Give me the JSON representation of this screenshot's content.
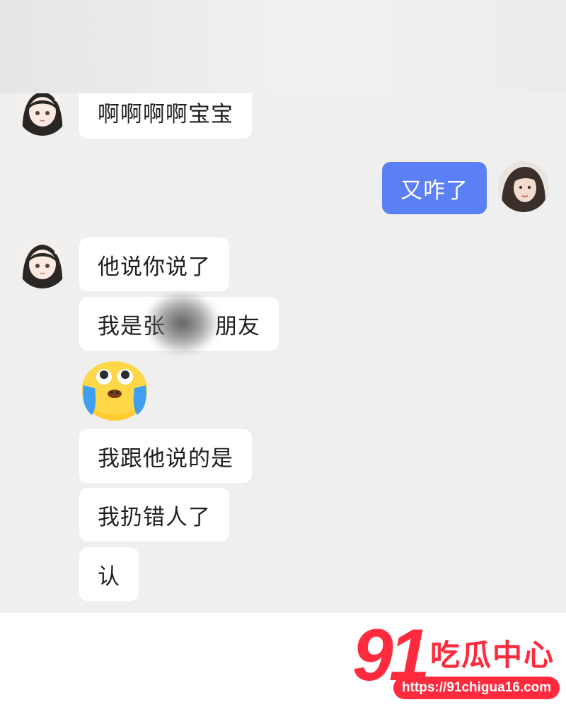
{
  "chat": {
    "messages": [
      {
        "side": "left",
        "text": "啊啊啊啊宝宝"
      },
      {
        "side": "right",
        "text": "又咋了"
      },
      {
        "side": "left",
        "text": "他说你说了"
      },
      {
        "side": "left",
        "text": "我是张",
        "text_after": "朋友"
      },
      {
        "side": "left",
        "type": "emoji",
        "icon": "crying-tears-emoji"
      },
      {
        "side": "left",
        "text": "我跟他说的是"
      },
      {
        "side": "left",
        "text": "我扔错人了"
      },
      {
        "side": "left",
        "text": "认"
      }
    ],
    "colors": {
      "chat_background": "#efefef",
      "incoming_bubble": "#ffffff",
      "outgoing_bubble": "#5b7ff4"
    }
  },
  "watermark": {
    "number": "91",
    "name": "吃瓜中心",
    "url": "https://91chigua16.com",
    "color": "#ff2a3d"
  }
}
